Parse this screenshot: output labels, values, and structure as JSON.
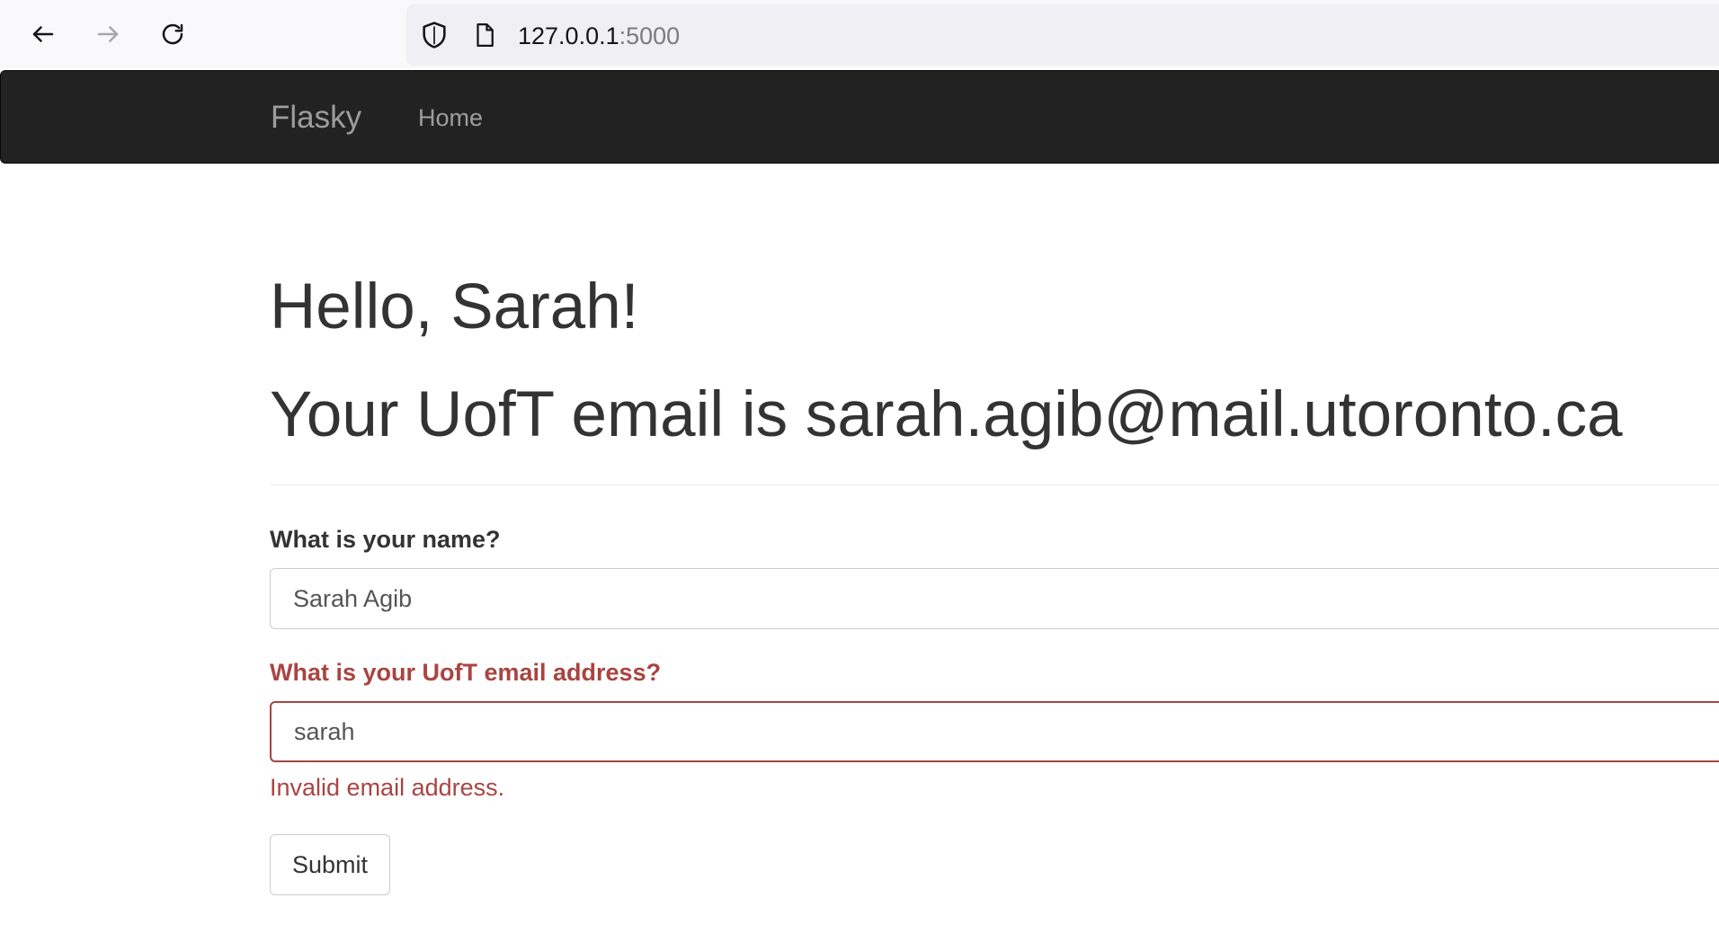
{
  "browser": {
    "url_host": "127.0.0.1",
    "url_port": ":5000",
    "icons": [
      "back-arrow-icon",
      "forward-arrow-icon",
      "reload-icon",
      "shield-icon",
      "page-icon"
    ]
  },
  "navbar": {
    "brand": "Flasky",
    "links": [
      "Home"
    ]
  },
  "main": {
    "greeting": "Hello, Sarah!",
    "email_line": "Your UofT email is sarah.agib@mail.utoronto.ca",
    "form": {
      "name_label": "What is your name?",
      "name_value": "Sarah Agib",
      "email_label": "What is your UofT email address?",
      "email_value": "sarah",
      "email_error": "Invalid email address.",
      "submit_label": "Submit"
    }
  },
  "colors": {
    "navbar_bg": "#222222",
    "navbar_text": "#9d9d9d",
    "error": "#a94442",
    "text": "#333333"
  }
}
